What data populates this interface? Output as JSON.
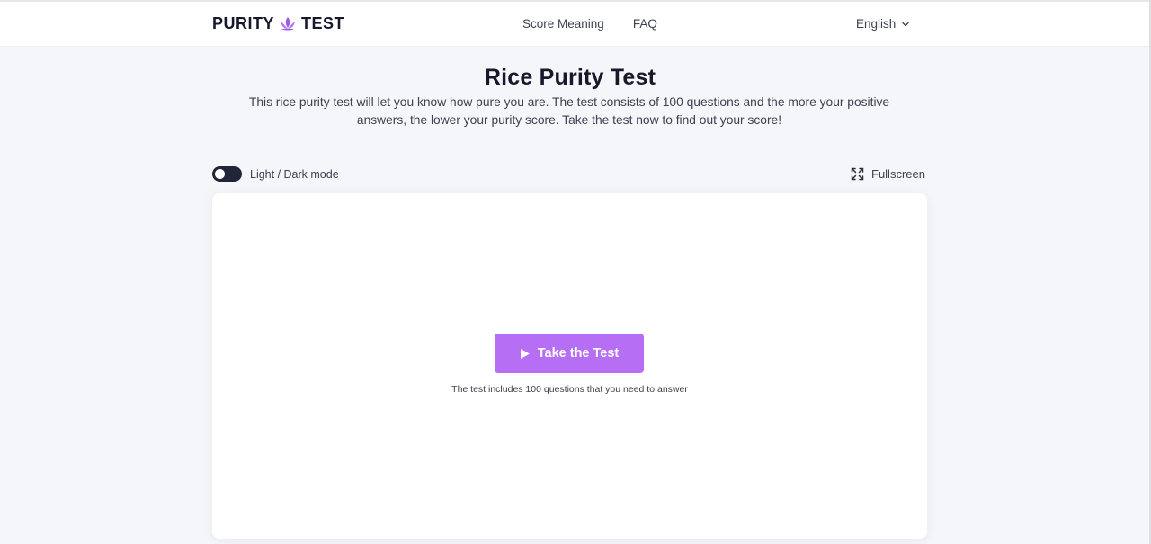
{
  "header": {
    "logo_left": "PURITY",
    "logo_right": "TEST",
    "nav": [
      {
        "label": "Score Meaning"
      },
      {
        "label": "FAQ"
      }
    ],
    "language": "English"
  },
  "hero": {
    "title": "Rice Purity Test",
    "description": "This rice purity test will let you know how pure you are. The test consists of 100 questions and the more your positive answers, the lower your purity score. Take the test now to find out your score!"
  },
  "controls": {
    "theme_toggle_label": "Light / Dark mode",
    "fullscreen_label": "Fullscreen"
  },
  "quiz": {
    "start_button_label": "Take the Test",
    "note": "The test includes 100 questions that you need to answer"
  },
  "colors": {
    "accent": "#b66ef5",
    "dark": "#16192b",
    "page_bg": "#f5f6f9"
  },
  "icons": {
    "logo": "lotus-icon",
    "language": "chevron-down-icon",
    "fullscreen": "expand-icon",
    "start": "play-icon"
  }
}
